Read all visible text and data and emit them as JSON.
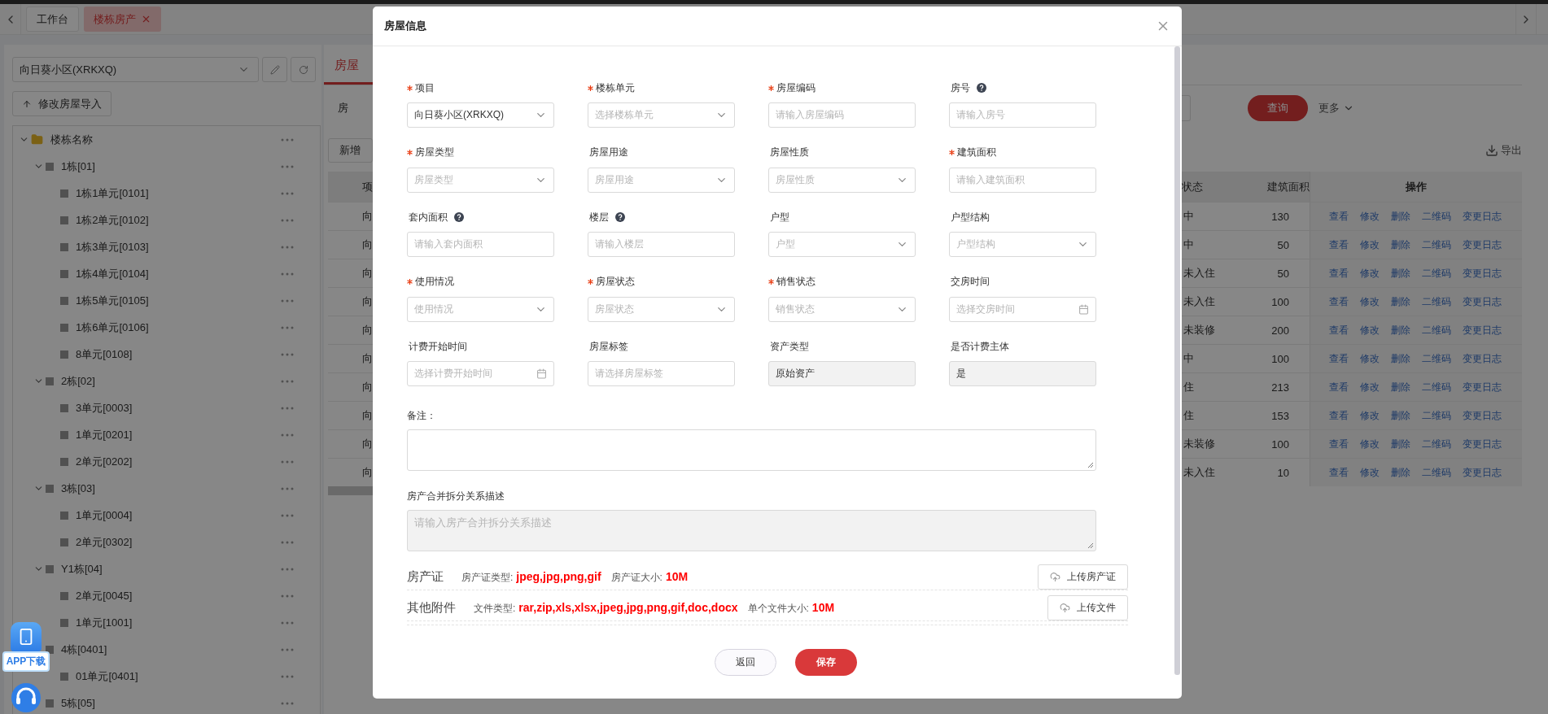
{
  "tabs": [
    {
      "label": "工作台",
      "selected": false,
      "closable": false
    },
    {
      "label": "楼栋房产",
      "selected": true,
      "closable": true
    }
  ],
  "sidebar": {
    "project_select": {
      "value": "向日葵小区(XRKXQ)"
    },
    "import_button": "修改房屋导入",
    "tree": [
      {
        "label": "楼栋名称",
        "kind": "folder",
        "expanded": true,
        "children": [
          {
            "label": "1栋[01]",
            "kind": "block",
            "expanded": true,
            "children": [
              {
                "label": "1栋1单元[0101]",
                "kind": "block"
              },
              {
                "label": "1栋2单元[0102]",
                "kind": "block"
              },
              {
                "label": "1栋3单元[0103]",
                "kind": "block"
              },
              {
                "label": "1栋4单元[0104]",
                "kind": "block"
              },
              {
                "label": "1栋5单元[0105]",
                "kind": "block"
              },
              {
                "label": "1栋6单元[0106]",
                "kind": "block"
              },
              {
                "label": "8单元[0108]",
                "kind": "block"
              }
            ]
          },
          {
            "label": "2栋[02]",
            "kind": "block",
            "expanded": true,
            "children": [
              {
                "label": "3单元[0003]",
                "kind": "block"
              },
              {
                "label": "1单元[0201]",
                "kind": "block"
              },
              {
                "label": "2单元[0202]",
                "kind": "block"
              }
            ]
          },
          {
            "label": "3栋[03]",
            "kind": "block",
            "expanded": true,
            "children": [
              {
                "label": "1单元[0004]",
                "kind": "block"
              },
              {
                "label": "2单元[0302]",
                "kind": "block"
              }
            ]
          },
          {
            "label": "Y1栋[04]",
            "kind": "block",
            "expanded": true,
            "children": [
              {
                "label": "2单元[0045]",
                "kind": "block"
              },
              {
                "label": "1单元[1001]",
                "kind": "block"
              }
            ]
          },
          {
            "label": "4栋[0401]",
            "kind": "block",
            "children": [
              {
                "label": "01单元[0401]",
                "kind": "block"
              }
            ]
          },
          {
            "label": "5栋[05]",
            "kind": "block"
          }
        ]
      }
    ]
  },
  "main": {
    "tab": "房屋",
    "filter_label": "房",
    "add_button": "新增",
    "query_button": "查询",
    "more_button": "更多",
    "export_button": "导出",
    "table": {
      "columns": [
        "项",
        "状态",
        "建筑面积",
        "操作"
      ],
      "rows": [
        {
          "project": "向",
          "status": "中",
          "area": "130",
          "actions": [
            "查看",
            "修改",
            "删除",
            "二维码",
            "变更日志"
          ]
        },
        {
          "project": "向",
          "status": "中",
          "area": "50",
          "actions": [
            "查看",
            "修改",
            "删除",
            "二维码",
            "变更日志"
          ]
        },
        {
          "project": "向",
          "status": "未入住",
          "area": "50",
          "actions": [
            "查看",
            "修改",
            "删除",
            "二维码",
            "变更日志"
          ]
        },
        {
          "project": "向",
          "status": "未入住",
          "area": "100",
          "actions": [
            "查看",
            "修改",
            "删除",
            "二维码",
            "变更日志"
          ]
        },
        {
          "project": "向",
          "status": "未装修",
          "area": "200",
          "actions": [
            "查看",
            "修改",
            "删除",
            "二维码",
            "变更日志"
          ]
        },
        {
          "project": "向",
          "status": "中",
          "area": "100",
          "actions": [
            "查看",
            "修改",
            "删除",
            "二维码",
            "变更日志"
          ]
        },
        {
          "project": "向",
          "status": "住",
          "area": "213",
          "actions": [
            "查看",
            "修改",
            "删除",
            "二维码",
            "变更日志"
          ]
        },
        {
          "project": "向",
          "status": "住",
          "area": "153",
          "actions": [
            "查看",
            "修改",
            "删除",
            "二维码",
            "变更日志"
          ]
        },
        {
          "project": "向",
          "status": "未装修",
          "area": "100",
          "actions": [
            "查看",
            "修改",
            "删除",
            "二维码",
            "变更日志"
          ]
        },
        {
          "project": "向",
          "status": "未入住",
          "area": "10",
          "actions": [
            "查看",
            "修改",
            "删除",
            "二维码",
            "变更日志"
          ]
        }
      ]
    }
  },
  "dialog": {
    "title": "房屋信息",
    "fields": [
      {
        "label": "项目",
        "required": true,
        "kind": "select",
        "value": "向日葵小区(XRKXQ)"
      },
      {
        "label": "楼栋单元",
        "required": true,
        "kind": "select",
        "placeholder": "选择楼栋单元"
      },
      {
        "label": "房屋编码",
        "required": true,
        "kind": "input",
        "placeholder": "请输入房屋编码"
      },
      {
        "label": "房号",
        "required": false,
        "help": true,
        "kind": "input",
        "placeholder": "请输入房号"
      },
      {
        "label": "房屋类型",
        "required": true,
        "kind": "select",
        "placeholder": "房屋类型"
      },
      {
        "label": "房屋用途",
        "required": false,
        "kind": "select",
        "placeholder": "房屋用途"
      },
      {
        "label": "房屋性质",
        "required": false,
        "kind": "select",
        "placeholder": "房屋性质"
      },
      {
        "label": "建筑面积",
        "required": true,
        "kind": "input",
        "placeholder": "请输入建筑面积"
      },
      {
        "label": "套内面积",
        "required": false,
        "help": true,
        "kind": "input",
        "placeholder": "请输入套内面积"
      },
      {
        "label": "楼层",
        "required": false,
        "help": true,
        "kind": "input",
        "placeholder": "请输入楼层"
      },
      {
        "label": "户型",
        "required": false,
        "kind": "select",
        "placeholder": "户型"
      },
      {
        "label": "户型结构",
        "required": false,
        "kind": "select",
        "placeholder": "户型结构"
      },
      {
        "label": "使用情况",
        "required": true,
        "kind": "select",
        "placeholder": "使用情况"
      },
      {
        "label": "房屋状态",
        "required": true,
        "kind": "select",
        "placeholder": "房屋状态"
      },
      {
        "label": "销售状态",
        "required": true,
        "kind": "select",
        "placeholder": "销售状态"
      },
      {
        "label": "交房时间",
        "required": false,
        "kind": "date",
        "placeholder": "选择交房时间"
      },
      {
        "label": "计费开始时间",
        "required": false,
        "kind": "date",
        "placeholder": "选择计费开始时间"
      },
      {
        "label": "房屋标签",
        "required": false,
        "kind": "input",
        "placeholder": "请选择房屋标签"
      },
      {
        "label": "资产类型",
        "required": false,
        "kind": "readonly",
        "value": "原始资产"
      },
      {
        "label": "是否计费主体",
        "required": false,
        "kind": "readonly",
        "value": "是"
      }
    ],
    "remark": {
      "label": "备注："
    },
    "relation": {
      "label": "房产合并拆分关系描述",
      "placeholder": "请输入房产合并拆分关系描述",
      "disabled": true
    },
    "attachments": [
      {
        "title": "房产证",
        "type_label": "房产证类型:",
        "types": "jpeg,jpg,png,gif",
        "size_label": "房产证大小:",
        "size": "10M",
        "button": "上传房产证"
      },
      {
        "title": "其他附件",
        "type_label": "文件类型:",
        "types": "rar,zip,xls,xlsx,jpeg,jpg,png,gif,doc,docx",
        "size_label": "单个文件大小:",
        "size": "10M",
        "button": "上传文件"
      }
    ],
    "buttons": [
      {
        "label": "返回",
        "kind": "secondary"
      },
      {
        "label": "保存",
        "kind": "primary"
      }
    ]
  },
  "float": {
    "app_download": "APP下载"
  }
}
